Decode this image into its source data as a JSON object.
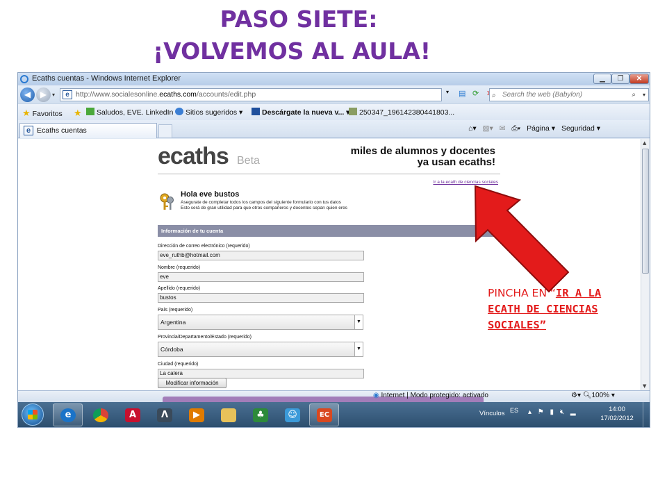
{
  "slide": {
    "title_line1": "PASO SIETE:",
    "title_line2": "¡VOLVEMOS AL AULA!",
    "note_plain": "PINCHA EN “",
    "note_link": "IR A LA ECATH DE CIENCIAS SOCIALES”",
    "colors": {
      "title": "#7030a0",
      "note": "#e31b1b",
      "arrow": "#e31b1b"
    }
  },
  "browser": {
    "window_title": "Ecaths cuentas - Windows Internet Explorer",
    "url_prefix": "http://www.socialesonline.",
    "url_domain": "ecaths.com",
    "url_path": "/accounts/edit.php",
    "search_placeholder": "Search the web (Babylon)",
    "favorites": {
      "label": "Favoritos",
      "items": [
        "Saludos, EVE. LinkedIn",
        "Sitios sugeridos ▾",
        "Descárgate la nueva v... ▾",
        "250347_196142380441803..."
      ]
    },
    "tab_label": "Ecaths cuentas",
    "command_bar": {
      "page_label": "Página ▾",
      "safety_label": "Seguridad ▾"
    },
    "status": {
      "zone": "Internet | Modo protegido: activado",
      "zoom": "100%"
    }
  },
  "page": {
    "logo": "ecaths",
    "logo_beta": "Beta",
    "tagline_line1": "miles de alumnos y docentes",
    "tagline_line2": "ya usan ecaths!",
    "link_text": "Ir a la ecath de ciencias sociales",
    "greeting": "Hola eve bustos",
    "greeting_sub1": "Asegurate de completar todos los campos del siguiente formulario con tus datos",
    "greeting_sub2": "Esto será de gran utilidad para que otros compañeros y docentes sepan quien eres",
    "section_header": "Información de tu cuenta",
    "fields": {
      "email_label": "Dirección de correo electrónico (requerido)",
      "email_value": "eve_ruthb@hotmail.com",
      "name_label": "Nombre (requerido)",
      "name_value": "eve",
      "surname_label": "Apellido (requerido)",
      "surname_value": "bustos",
      "country_label": "País (requerido)",
      "country_value": "Argentina",
      "province_label": "Provincia/Departamento/Estado (requerido)",
      "province_value": "Córdoba",
      "city_label": "Ciudad (requerido)",
      "city_value": "La calera"
    },
    "submit_label": "Modificar información"
  },
  "taskbar": {
    "links_label": "Vínculos",
    "lang": "ES",
    "time": "14:00",
    "date": "17/02/2012"
  }
}
